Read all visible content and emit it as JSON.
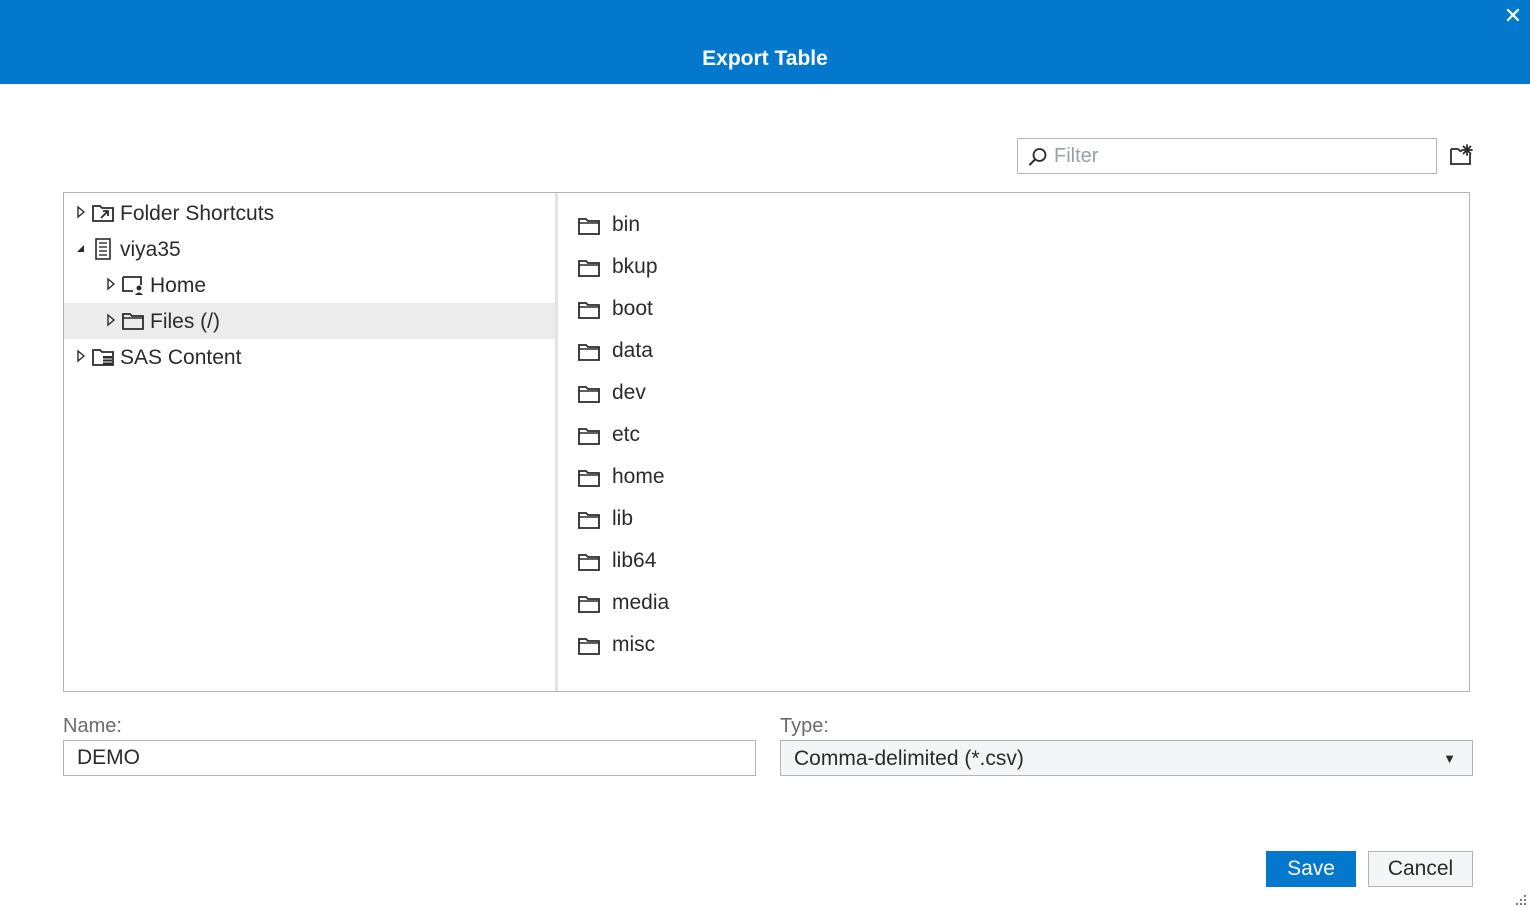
{
  "dialog": {
    "title": "Export Table",
    "close_symbol": "✕"
  },
  "filter": {
    "placeholder": "Filter",
    "value": ""
  },
  "toolbar": {
    "new_folder_icon": "new-folder-icon"
  },
  "tree": {
    "items": [
      {
        "label": "Folder Shortcuts",
        "icon": "folder-shortcut-icon",
        "expanded": false,
        "level": 0
      },
      {
        "label": "viya35",
        "icon": "server-icon",
        "expanded": true,
        "level": 0
      },
      {
        "label": "Home",
        "icon": "home-folder-icon",
        "expanded": false,
        "level": 1
      },
      {
        "label": "Files (/)",
        "icon": "folder-icon",
        "expanded": false,
        "level": 1,
        "selected": true
      },
      {
        "label": "SAS Content",
        "icon": "content-folder-icon",
        "expanded": false,
        "level": 0
      }
    ]
  },
  "list": {
    "items": [
      {
        "label": "bin"
      },
      {
        "label": "bkup"
      },
      {
        "label": "boot"
      },
      {
        "label": "data"
      },
      {
        "label": "dev"
      },
      {
        "label": "etc"
      },
      {
        "label": "home"
      },
      {
        "label": "lib"
      },
      {
        "label": "lib64"
      },
      {
        "label": "media"
      },
      {
        "label": "misc"
      }
    ]
  },
  "form": {
    "name_label": "Name:",
    "name_value": "DEMO",
    "type_label": "Type:",
    "type_value": "Comma-delimited (*.csv)",
    "type_arrow": "▼"
  },
  "actions": {
    "save_label": "Save",
    "cancel_label": "Cancel"
  },
  "colors": {
    "accent": "#0378cd",
    "selected_row": "#ececec",
    "border": "#b4b4b4"
  }
}
